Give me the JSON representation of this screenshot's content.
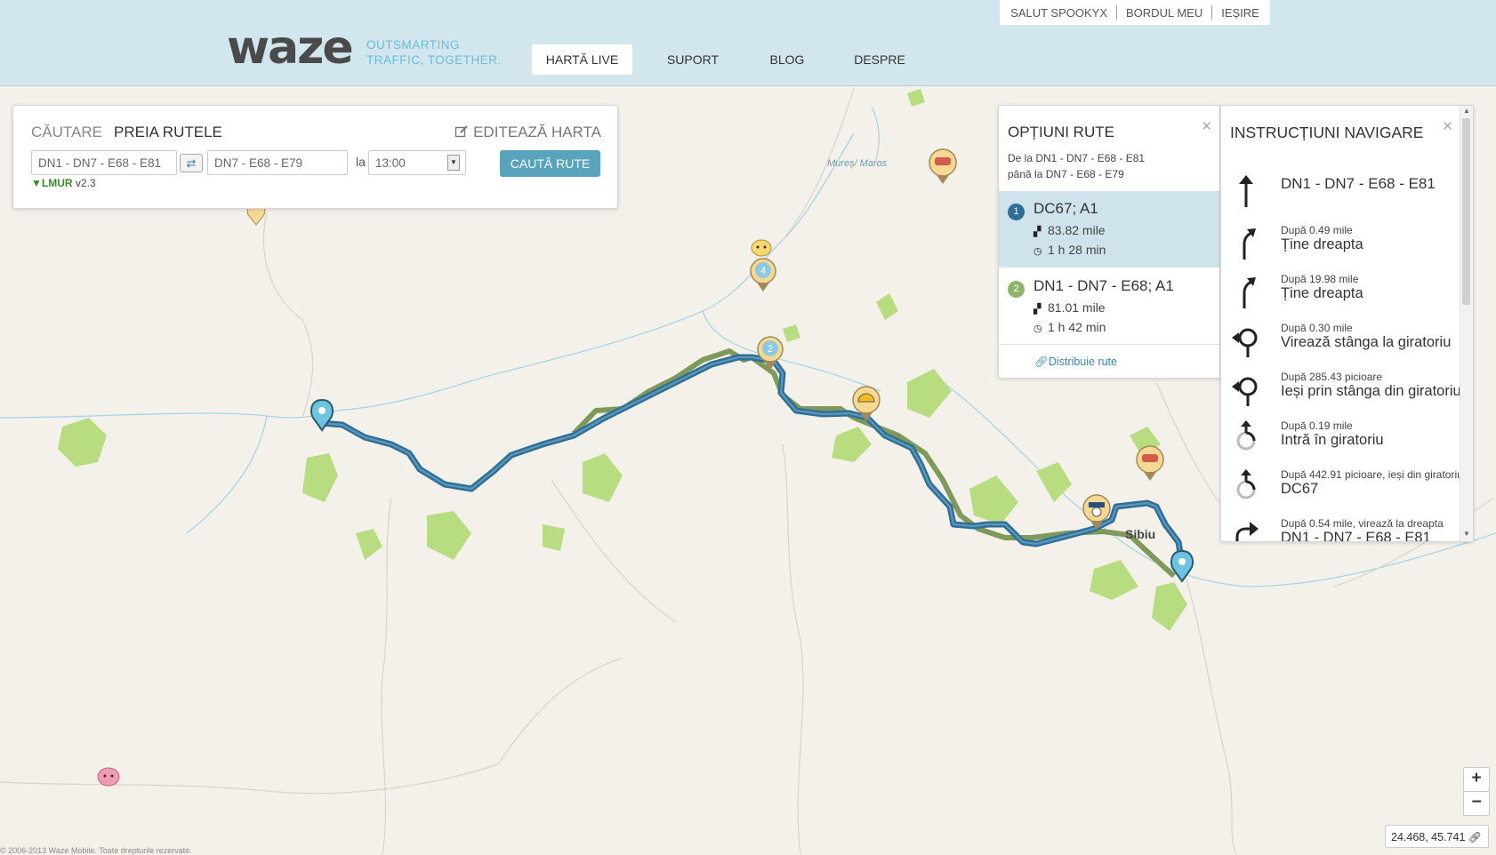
{
  "header": {
    "logo": "waze",
    "tagline_line1": "OUTSMARTING",
    "tagline_line2": "TRAFFIC, TOGETHER.",
    "nav": [
      "HARTĂ LIVE",
      "SUPORT",
      "BLOG",
      "DESPRE"
    ],
    "user_links": [
      "SALUT SPOOKYX",
      "BORDUL MEU",
      "IEȘIRE"
    ]
  },
  "search_panel": {
    "tab_search": "CĂUTARE",
    "tab_routes": "PREIA RUTELE",
    "edit_map": "EDITEAZĂ HARTA",
    "from_value": "DN1 - DN7 - E68 - E81",
    "to_value": "DN7 - E68 - E79",
    "at_label": "la",
    "time_value": "13:00",
    "search_button": "CAUTĂ RUTE",
    "version_brand": "LMUR",
    "version": "v2.3"
  },
  "route_options": {
    "title": "OPȚIUNI RUTE",
    "from": "De la DN1 - DN7 - E68 - E81",
    "to": "până la DN7 - E68 - E79",
    "routes": [
      {
        "number": "1",
        "name": "DC67; A1",
        "distance": "83.82 mile",
        "duration": "1 h 28 min",
        "color": "#2f6f96",
        "selected": true
      },
      {
        "number": "2",
        "name": "DN1 - DN7 - E68; A1",
        "distance": "81.01 mile",
        "duration": "1 h 42 min",
        "color": "#8fb469",
        "selected": false
      }
    ],
    "share": "Distribuie rute"
  },
  "directions": {
    "title": "INSTRUCȚIUNI NAVIGARE",
    "steps": [
      {
        "icon": "straight-arrow-icon",
        "distance": "",
        "instruction": "DN1 - DN7 - E68 - E81"
      },
      {
        "icon": "keep-right-icon",
        "distance": "După 0.49 mile",
        "instruction": "Ține dreapta"
      },
      {
        "icon": "keep-right-icon",
        "distance": "După 19.98 mile",
        "instruction": "Ține dreapta"
      },
      {
        "icon": "roundabout-left-icon",
        "distance": "După 0.30 mile",
        "instruction": "Virează stânga la giratoriu"
      },
      {
        "icon": "roundabout-exit-left-icon",
        "distance": "După 285.43 picioare",
        "instruction": "Ieși prin stânga din giratoriu"
      },
      {
        "icon": "roundabout-enter-icon",
        "distance": "După 0.19 mile",
        "instruction": "Intră în giratoriu"
      },
      {
        "icon": "roundabout-enter-icon",
        "distance": "După 442.91 picioare, ieși din giratoriu",
        "instruction": "DC67"
      },
      {
        "icon": "turn-right-icon",
        "distance": "După 0.54 mile, virează la dreapta",
        "instruction": "DN1 - DN7 - E68 - E81"
      }
    ]
  },
  "map": {
    "river_label": "Mureș/ Maros",
    "city_label": "Sibiu",
    "marker_numbers": [
      "4",
      "2"
    ],
    "zoom_in": "+",
    "zoom_out": "−",
    "coordinates": "24.468, 45.741",
    "copyright": "© 2006-2013 Waze Mobile. Toate drepturile rezervate."
  },
  "colors": {
    "header_bg": "#d2e6ee",
    "accent": "#5aa3bd",
    "route_primary": "#2f6f96",
    "route_alternative": "#8fb469",
    "selected_route_bg": "#cfe3ec",
    "park_green": "#b8dc80"
  }
}
